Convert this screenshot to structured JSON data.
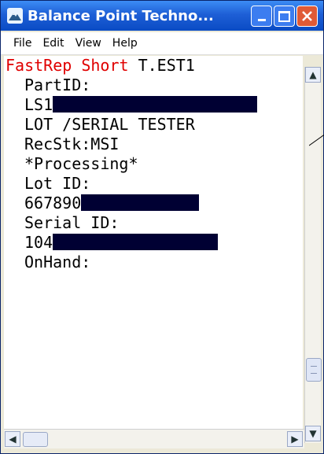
{
  "window": {
    "title": "Balance Point Techno...",
    "icon": "mountain-app-icon",
    "controls": [
      "minimize-icon",
      "maximize-icon",
      "close-icon"
    ]
  },
  "menu": [
    {
      "label": "File",
      "key": "F"
    },
    {
      "label": "Edit",
      "key": "E"
    },
    {
      "label": "View",
      "key": "V"
    },
    {
      "label": "Help",
      "key": "H"
    }
  ],
  "screen": {
    "header_red": "FastRep Short",
    "header_black": " T.EST1",
    "part_label": "PartID:",
    "part_value": "LS1",
    "description": "LOT /SERIAL TESTER",
    "recstk": "RecStk:MSI",
    "status": "*Processing*",
    "lot_label": "Lot ID:",
    "lot_value": "667890",
    "serial_label": "Serial ID:",
    "serial_value": "104",
    "onhand_label": "OnHand:"
  },
  "colors": {
    "accent_red": "#e00000",
    "redaction": "#000033",
    "titlebar": "#1e5fd6"
  }
}
